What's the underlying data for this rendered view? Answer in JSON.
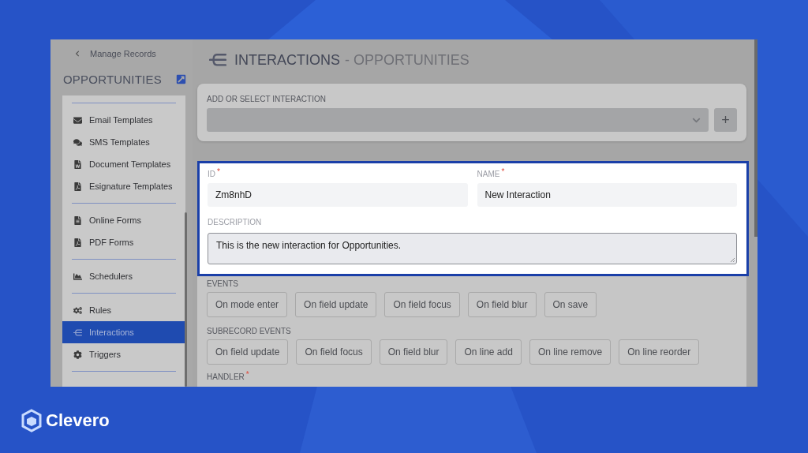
{
  "sidebar": {
    "back_link": "Manage Records",
    "title": "OPPORTUNITIES",
    "groups": [
      {
        "items": [
          {
            "label": "Email Templates",
            "selected": false
          },
          {
            "label": "SMS Templates",
            "selected": false
          },
          {
            "label": "Document Templates",
            "selected": false
          },
          {
            "label": "Esignature Templates",
            "selected": false
          }
        ]
      },
      {
        "items": [
          {
            "label": "Online Forms",
            "selected": false
          },
          {
            "label": "PDF Forms",
            "selected": false
          }
        ]
      },
      {
        "items": [
          {
            "label": "Schedulers",
            "selected": false
          }
        ]
      },
      {
        "items": [
          {
            "label": "Rules",
            "selected": false
          },
          {
            "label": "Interactions",
            "selected": true
          },
          {
            "label": "Triggers",
            "selected": false
          }
        ]
      }
    ]
  },
  "header": {
    "title": "INTERACTIONS",
    "subtitle": "- OPPORTUNITIES"
  },
  "interaction_picker": {
    "label": "ADD OR SELECT INTERACTION",
    "add_button": "+"
  },
  "details": {
    "id": {
      "label": "ID",
      "required_mark": "*",
      "value": "Zm8nhD"
    },
    "name": {
      "label": "NAME",
      "required_mark": "*",
      "value": "New Interaction"
    },
    "description": {
      "label": "DESCRIPTION",
      "value": "This is the new interaction for Opportunities."
    }
  },
  "events": {
    "label": "EVENTS",
    "items": [
      "On mode enter",
      "On field update",
      "On field focus",
      "On field blur",
      "On save"
    ]
  },
  "subrecord_events": {
    "label": "SUBRECORD EVENTS",
    "items": [
      "On field update",
      "On field focus",
      "On field blur",
      "On line add",
      "On line remove",
      "On line reorder"
    ]
  },
  "handler": {
    "label": "HANDLER",
    "required_mark": "*"
  },
  "brand": {
    "name": "Clevero"
  }
}
